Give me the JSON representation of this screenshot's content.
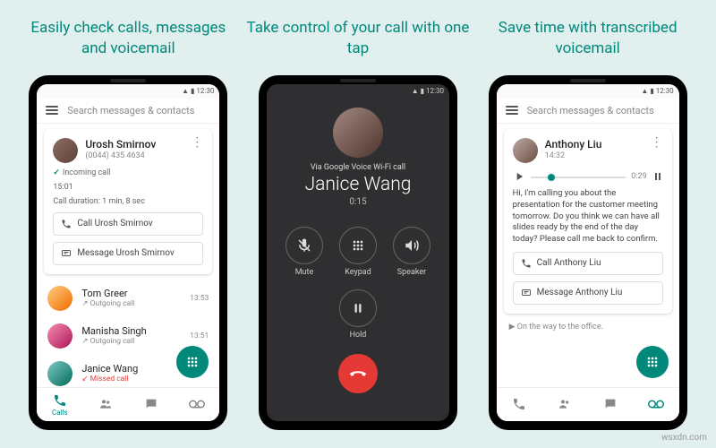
{
  "headlines": [
    "Easily check calls, messages and voicemail",
    "Take control of your call with one tap",
    "Save time with transcribed voicemail"
  ],
  "search_placeholder": "Search messages & contacts",
  "s1": {
    "card": {
      "name": "Urosh Smirnov",
      "phone": "(0044) 435 4634",
      "status": "Incoming call",
      "time": "15:01",
      "duration": "Call duration: 1 min, 8 sec",
      "call_btn": "Call Urosh Smirnov",
      "msg_btn": "Message Urosh Smirnov"
    },
    "list": [
      {
        "name": "Tom Greer",
        "sub": "Outgoing call",
        "time": "13:53"
      },
      {
        "name": "Manisha Singh",
        "sub": "Outgoing call",
        "time": "13:51"
      },
      {
        "name": "Janice Wang",
        "sub": "Missed call",
        "time": ""
      }
    ],
    "tabs": [
      "Calls",
      "Contacts",
      "Messages",
      "Voicemail"
    ]
  },
  "s2": {
    "via": "Via Google Voice Wi-Fi call",
    "name": "Janice Wang",
    "dur": "0:15",
    "ctl": [
      "Mute",
      "Keypad",
      "Speaker"
    ],
    "hold": "Hold"
  },
  "s3": {
    "name": "Anthony Liu",
    "time": "14:32",
    "len": "0:29",
    "transcript": "Hi, I'm calling you about the presentation for the customer meeting tomorrow. Do you think we can have all slides ready by the end of the day today? Please call me back to confirm.",
    "call_btn": "Call Anthony Liu",
    "msg_btn": "Message Anthony Liu",
    "nowp": "On the way to the office."
  },
  "watermark": "wsxdn.com"
}
